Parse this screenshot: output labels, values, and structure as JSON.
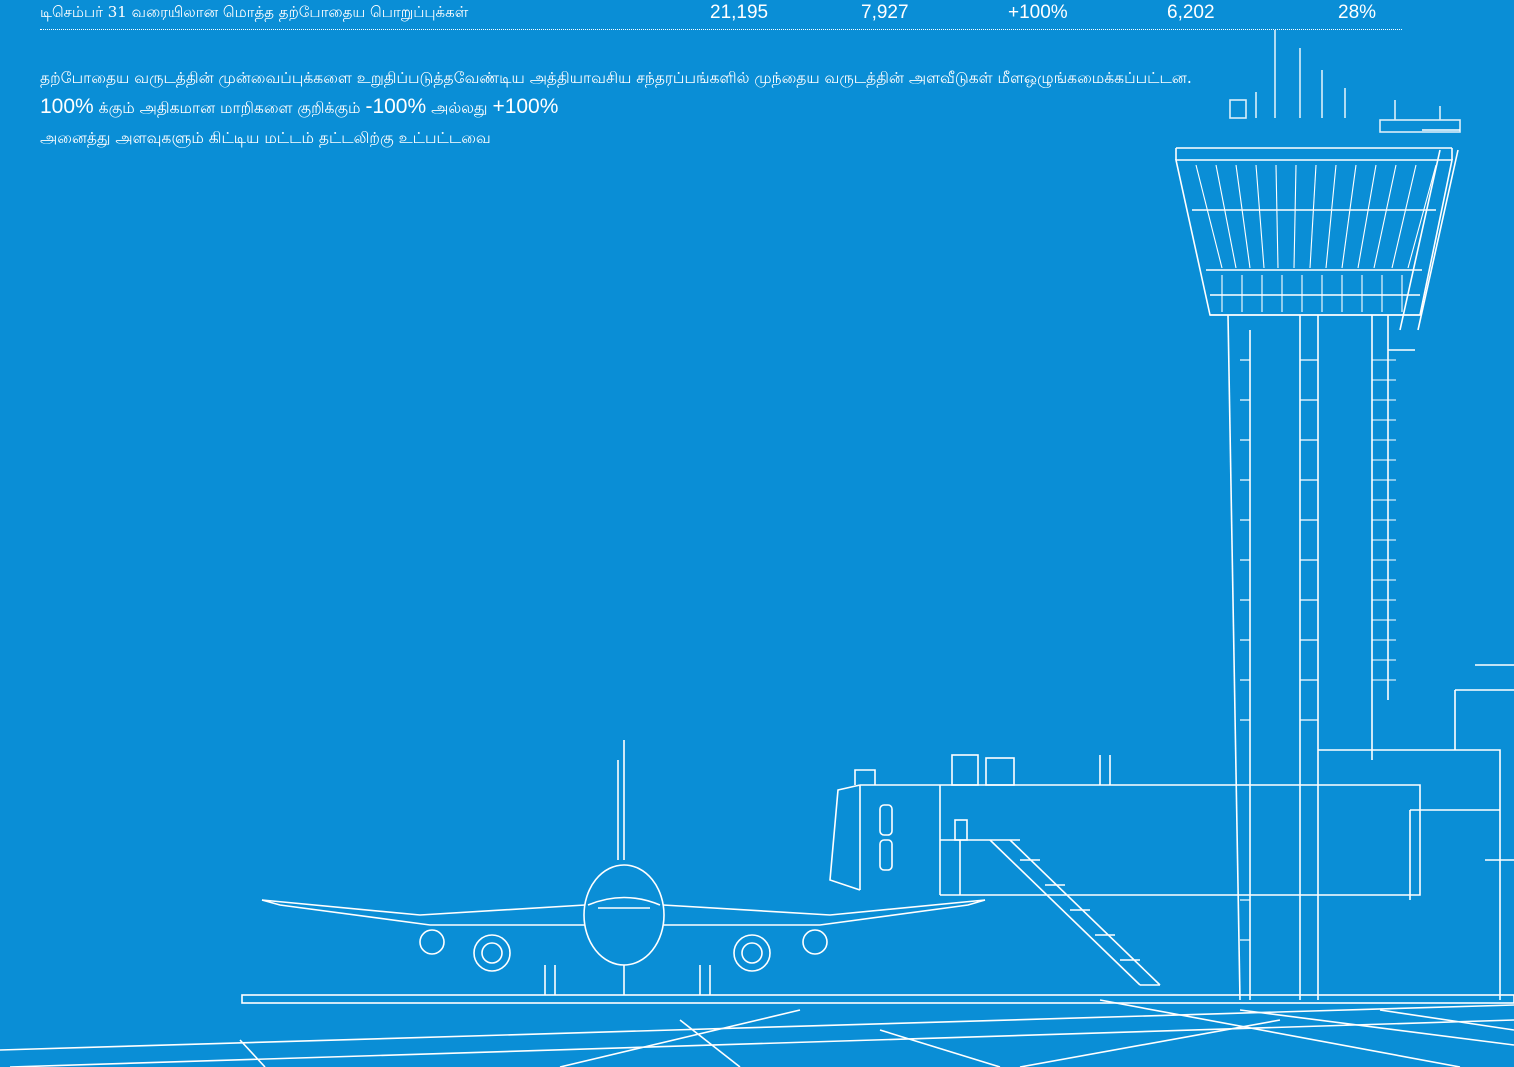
{
  "table": {
    "row": {
      "label": "டிசெம்பர் 31 வரையிலான மொத்த தற்போதைய பொறுப்புக்கள்",
      "values": [
        "21,195",
        "7,927",
        "+100%",
        "6,202",
        "28%"
      ]
    }
  },
  "notes": {
    "para1": "தற்போதைய வருடத்தின் முன்வைப்புக்களை உறுதிப்படுத்தவேண்டிய அத்தியாவசிய சந்தரப்பங்களில் முந்தைய வருடத்தின் அளவீடுகள் மீளஒழுங்கமைக்கப்பட்டன.",
    "line2": {
      "pct1": "100%",
      "text1": "க்கும் அதிகமான மாறிகளை குறிக்கும்",
      "pct2": "-100%",
      "text2": "அல்லது",
      "pct3": "+100%"
    },
    "line3": "அனைத்து அளவுகளும் கிட்டிய மட்டம் தட்டலிற்கு உட்பட்டவை"
  },
  "colors": {
    "background": "#0a8ed6",
    "line_art": "#ffffff"
  }
}
